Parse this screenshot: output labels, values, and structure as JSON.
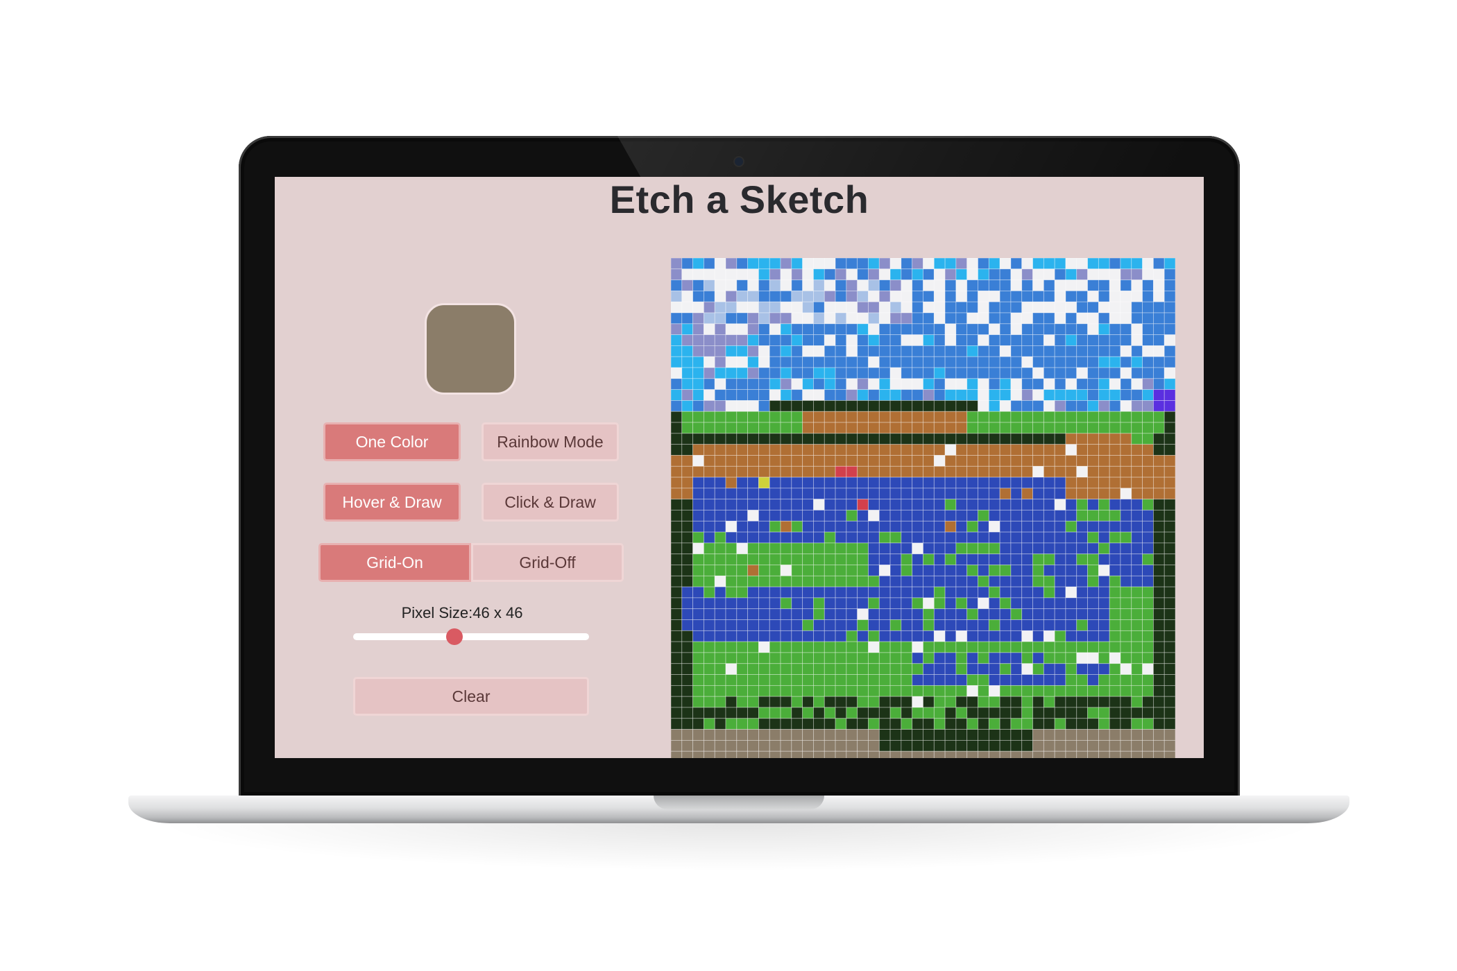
{
  "app": {
    "title": "Etch a Sketch"
  },
  "color_picker": {
    "current_color": "#8b7d69"
  },
  "controls": {
    "color_mode": [
      {
        "label": "One Color",
        "active": true
      },
      {
        "label": "Rainbow Mode",
        "active": false
      }
    ],
    "draw_mode": [
      {
        "label": "Hover & Draw",
        "active": true
      },
      {
        "label": "Click & Draw",
        "active": false
      }
    ],
    "grid_toggle": [
      {
        "label": "Grid-On",
        "active": true
      },
      {
        "label": "Grid-Off",
        "active": false
      }
    ],
    "pixel_size_label": "Pixel Size:46 x 46",
    "pixel_size_value": 46,
    "pixel_size_fraction": 0.43,
    "clear_label": "Clear"
  },
  "canvas": {
    "grid_size": 46,
    "grid_on": true,
    "palette": {
      "W": "#f2f2f4",
      "L": "#3a7fd6",
      "C": "#2bb3ee",
      "P": "#8b8ec9",
      "S": "#a8c1e6",
      "D": "#2d49b8",
      "V": "#5a2fe0",
      "B": "#b06f34",
      "G": "#4bae3a",
      "K": "#1c3317",
      "T": "#8b7d69",
      "R": "#d2404c",
      "Y": "#cfd23a"
    }
  }
}
